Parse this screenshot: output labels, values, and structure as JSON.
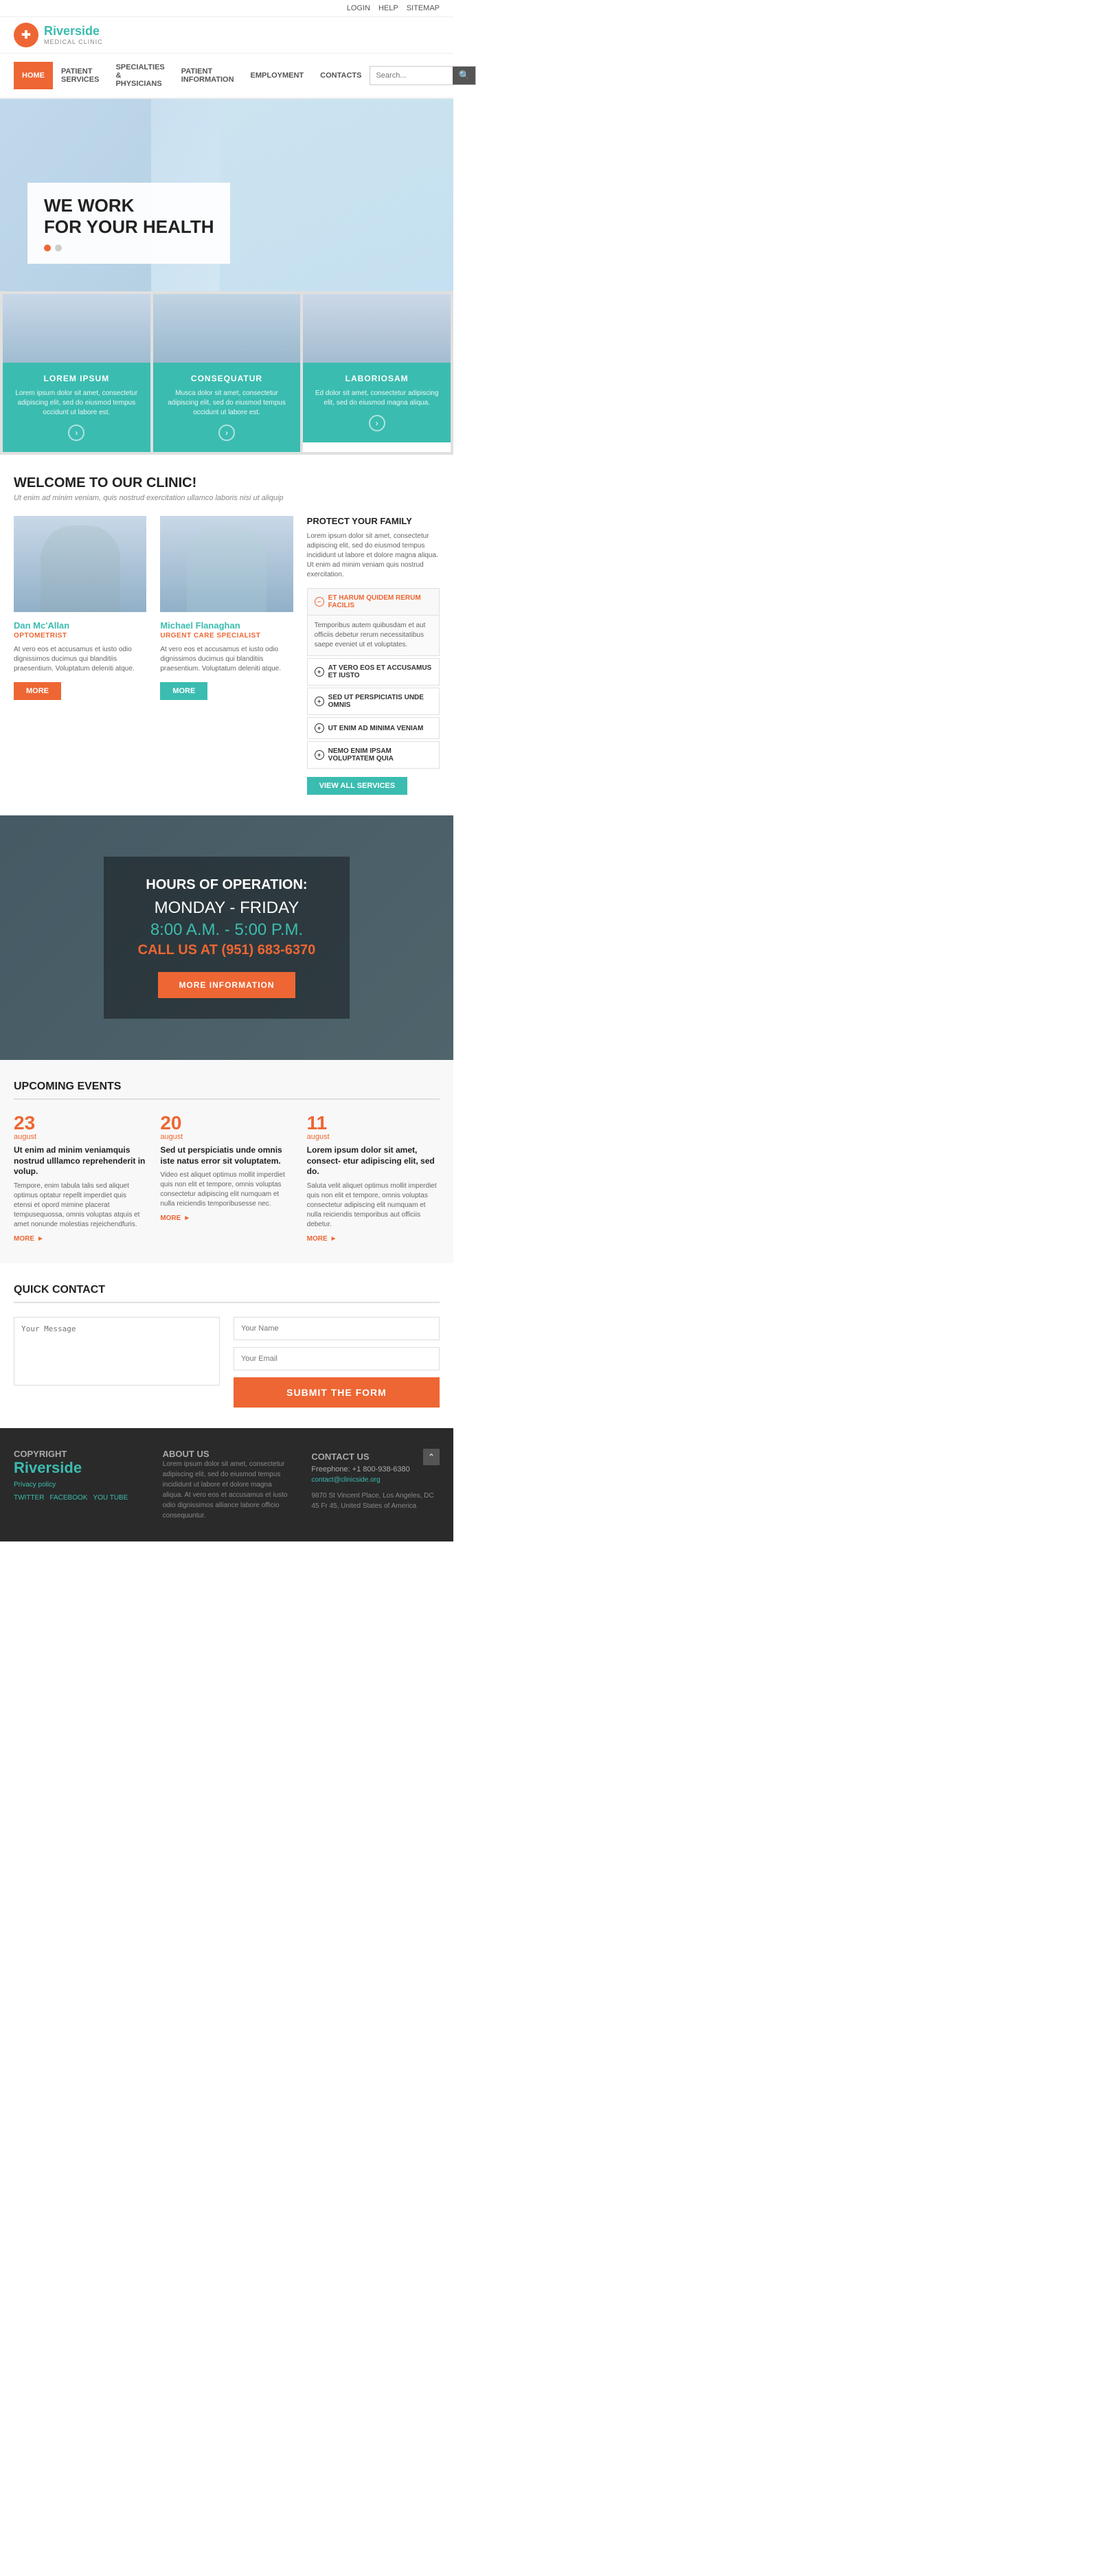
{
  "topbar": {
    "login": "LOGIN",
    "help": "HELP",
    "sitemap": "SITEMAP"
  },
  "header": {
    "logo_text": "Riverside",
    "logo_sub": "MEDICAL CLINIC",
    "logo_icon": "+"
  },
  "nav": {
    "items": [
      {
        "label": "HOME",
        "active": true
      },
      {
        "label": "PATIENT SERVICES",
        "active": false
      },
      {
        "label": "SPECIALTIES & PHYSICIANS",
        "active": false
      },
      {
        "label": "PATIENT INFORMATION",
        "active": false
      },
      {
        "label": "EMPLOYMENT",
        "active": false
      },
      {
        "label": "CONTACTS",
        "active": false
      }
    ],
    "search_placeholder": "Search..."
  },
  "hero": {
    "title_line1": "WE WORK",
    "title_line2": "FOR YOUR HEALTH"
  },
  "services": [
    {
      "title": "LOREM IPSUM",
      "desc": "Lorem ipsum dolor sit amet, consectetur adipiscing elit, sed do eiusmod tempus occidunt ut labore est."
    },
    {
      "title": "CONSEQUATUR",
      "desc": "Musca dolor sit amet, consectetur adipiscing elit, sed do eiusmod tempus occidunt ut labore est."
    },
    {
      "title": "LABORIOSAM",
      "desc": "Ed dolor sit amet, consectetur adipiscing elit, sed do eiusmod magna aliqua."
    }
  ],
  "welcome": {
    "title": "WELCOME TO OUR CLINIC!",
    "subtitle": "Ut enim ad minim veniam, quis nostrud exercitation ullamco laboris nisi ut aliquip"
  },
  "doctors": [
    {
      "name": "Dan Mc'Allan",
      "specialty": "OPTOMETRIST",
      "desc": "At vero eos et accusamus et iusto odio dignissimos ducimus qui blanditiis praesentium. Voluptatum deleniti atque."
    },
    {
      "name": "Michael Flanaghan",
      "specialty": "URGENT CARE SPECIALIST",
      "desc": "At vero eos et accusamus et iusto odio dignissimos ducimus qui blanditiis praesentium. Voluptatum deleniti atque."
    }
  ],
  "protect": {
    "title": "PROTECT YOUR FAMILY",
    "desc": "Lorem ipsum dolor sit amet, consectetur adipiscing elit, sed do eiusmod tempus incididunt ut labore et dolore magna aliqua. Ut enim ad minim veniam quis nostrud exercitation.",
    "accordion": [
      {
        "label": "ET HARUM QUIDEM RERUM FACILIS",
        "open": true,
        "body": "Temporibus autem quibusdam et aut officiis debetur rerum necessitatibus saepe eveniet ut et voluptates."
      },
      {
        "label": "AT VERO EOS ET ACCUSAMUS ET IUSTO",
        "open": false,
        "body": ""
      },
      {
        "label": "SED UT PERSPICIATIS UNDE OMNIS",
        "open": false,
        "body": ""
      },
      {
        "label": "UT ENIM AD MINIMA VENIAM",
        "open": false,
        "body": ""
      },
      {
        "label": "NEMO ENIM IPSAM VOLUPTATEM QUIA",
        "open": false,
        "body": ""
      }
    ],
    "view_all": "View All Services"
  },
  "hours": {
    "label": "HOURS OF OPERATION:",
    "days": "MONDAY - FRIDAY",
    "time_start": "8:00",
    "time_start_label": "A.M. -",
    "time_end": "5:00 P.M.",
    "phone_label": "CALL US AT",
    "phone": "(951) 683-6370",
    "btn": "MORE INFORMATION"
  },
  "events": {
    "title": "UPCOMING EVENTS",
    "items": [
      {
        "day": "23",
        "month": "august",
        "headline": "Ut enim ad minim veniamquis nostrud ulllamco reprehenderit in volup.",
        "desc": "Tempore, enim tabula talis sed aliquet optimus optatur repellt imperdiet quis etensi et opord mimine placerat tempusequossa, omnis voluptas atquis et amet nonunde molestias rejeichendfuris."
      },
      {
        "day": "20",
        "month": "august",
        "headline": "Sed ut perspiciatis unde omnis iste natus error sit voluptatem.",
        "desc": "Video est aliquet optimus mollit imperdiet quis non elit et tempore, omnis voluptas consectetur adipiscing elit numquam et nulla reiciendis temporibusesse nec."
      },
      {
        "day": "11",
        "month": "august",
        "headline": "Lorem ipsum dolor sit amet, consect- etur adipiscing elit, sed do.",
        "desc": "Saluta velit aliquet optimus mollit imperdiet quis non elit et tempore, omnis voluptas consectetur adipiscing elit numquam et nulla reiciendis temporibus aut officiis debetur."
      }
    ],
    "more_label": "MORE"
  },
  "quick_contact": {
    "title": "QUICK CONTACT",
    "message_placeholder": "Your Message",
    "name_placeholder": "Your Name",
    "email_placeholder": "Your Email",
    "submit_label": "SUBMIT THE FORM"
  },
  "footer": {
    "copyright_label": "COPYRIGHT",
    "logo": "Riverside",
    "privacy": "Privacy policy",
    "social": [
      "TWITTER",
      "FACEBOOK",
      "YOU TUBE"
    ],
    "about_title": "ABOUT US",
    "about_desc": "Lorem ipsum dolor sit amet, consectetur adipiscing elit, sed do eiusmod tempus incididunt ut labore et dolore magna aliqua. At vero eos et accusamus et iusto odio dignissimos alliance labore officio consequuntur.",
    "contact_title": "CONTACT US",
    "phone": "Freephone: +1 800-938-6380",
    "email": "contact@clinicside.org",
    "address": "9870 St Vincent Place,\nLos Angeles, DC 45 Fr 45,\nUnited States of America"
  }
}
